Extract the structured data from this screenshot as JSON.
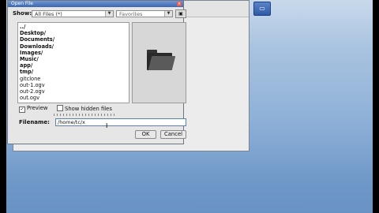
{
  "dialog": {
    "title": "Open File",
    "close_glyph": "×",
    "show_label": "Show:",
    "filter_value": "All Files (*)",
    "favorites_value": "Favorites",
    "files": [
      {
        "name": "../",
        "dir": true
      },
      {
        "name": "Desktop/",
        "dir": true
      },
      {
        "name": "Documents/",
        "dir": true
      },
      {
        "name": "Downloads/",
        "dir": true
      },
      {
        "name": "Images/",
        "dir": true
      },
      {
        "name": "Music/",
        "dir": true
      },
      {
        "name": "app/",
        "dir": true
      },
      {
        "name": "tmp/",
        "dir": true
      },
      {
        "name": "gitclone",
        "dir": false
      },
      {
        "name": "out-1.ogv",
        "dir": false
      },
      {
        "name": "out-2.ogv",
        "dir": false
      },
      {
        "name": "out.ogv",
        "dir": false
      }
    ],
    "preview_label": "Preview",
    "preview_checked": true,
    "hidden_label": "Show hidden files",
    "hidden_checked": false,
    "filename_label": "Filename:",
    "filename_value": "/home/tc/x",
    "ok_label": "OK",
    "cancel_label": "Cancel"
  },
  "icons": {
    "dropdown": "chevron-down-icon",
    "new_folder": "new-folder-icon",
    "preview": "folder-icon",
    "tray": "window-icon"
  },
  "colors": {
    "titlebar": "#3d66b0",
    "desktop": "#8fb1d8"
  }
}
